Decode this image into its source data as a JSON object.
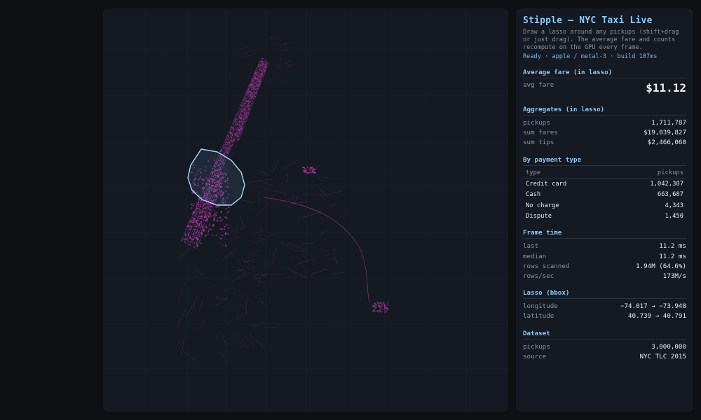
{
  "panel": {
    "title": "Stipple — NYC Taxi Live",
    "description": "Draw a lasso around any pickups (shift+drag or just drag). The average fare and counts recompute on the GPU every frame.",
    "status": "Ready · apple / metal-3 · build 107ms",
    "avg_fare": {
      "heading": "Average fare (in lasso)",
      "label": "avg fare",
      "value": "$11.12"
    },
    "aggregates": {
      "heading": "Aggregates (in lasso)",
      "rows": [
        {
          "label": "pickups",
          "value": "1,711,787"
        },
        {
          "label": "sum fares",
          "value": "$19,039,827"
        },
        {
          "label": "sum tips",
          "value": "$2,466,060"
        }
      ]
    },
    "payment": {
      "heading": "By payment type",
      "col_type": "type",
      "col_pickups": "pickups",
      "rows": [
        {
          "type": "Credit card",
          "pickups": "1,042,307"
        },
        {
          "type": "Cash",
          "pickups": "663,687"
        },
        {
          "type": "No charge",
          "pickups": "4,343"
        },
        {
          "type": "Dispute",
          "pickups": "1,450"
        }
      ]
    },
    "frame_time": {
      "heading": "Frame time",
      "rows": [
        {
          "label": "last",
          "value": "11.2 ms"
        },
        {
          "label": "median",
          "value": "11.2 ms"
        },
        {
          "label": "rows scanned",
          "value": "1.94M (64.6%)"
        },
        {
          "label": "rows/sec",
          "value": "173M/s"
        }
      ]
    },
    "lasso": {
      "heading": "Lasso (bbox)",
      "rows": [
        {
          "label": "longitude",
          "value": "−74.017 → −73.948"
        },
        {
          "label": "latitude",
          "value": "40.739 → 40.791"
        }
      ]
    },
    "dataset": {
      "heading": "Dataset",
      "rows": [
        {
          "label": "pickups",
          "value": "3,000,000"
        },
        {
          "label": "source",
          "value": "NYC TLC 2015"
        }
      ]
    }
  },
  "colors": {
    "background": "#0e1014",
    "panel": "#141922",
    "accent": "#8ec7f5",
    "points": "#c040b0",
    "lasso": "#a8d8ff"
  }
}
